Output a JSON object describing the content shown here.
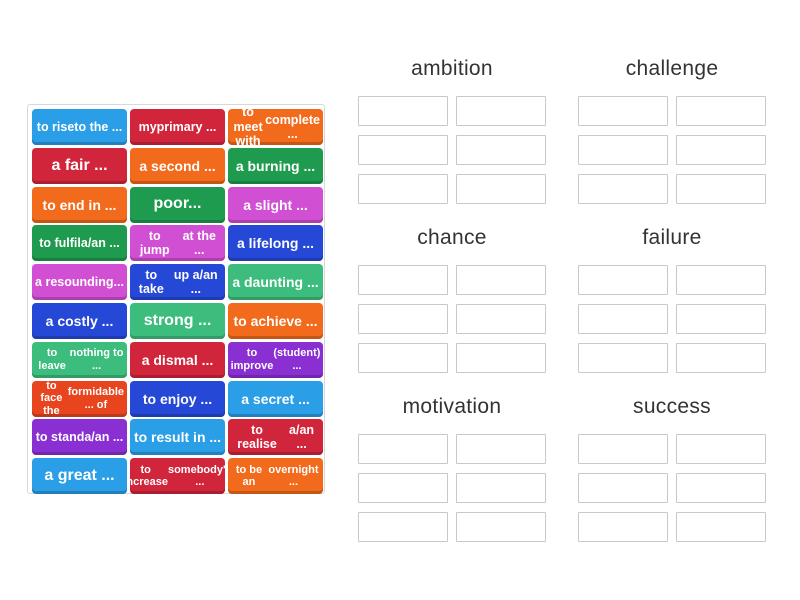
{
  "tiles": [
    {
      "text": "to rise\nto the ...",
      "color": "#2a9ee6"
    },
    {
      "text": "my\nprimary ...",
      "color": "#d1253c"
    },
    {
      "text": "to meet with\ncomplete ...",
      "color": "#f26a1b"
    },
    {
      "text": "a fair ...",
      "color": "#d1253c"
    },
    {
      "text": "a second ...",
      "color": "#f26a1b"
    },
    {
      "text": "a burning ...",
      "color": "#1e9b4e"
    },
    {
      "text": "to end in ...",
      "color": "#f26a1b"
    },
    {
      "text": "poor...",
      "color": "#1e9b4e"
    },
    {
      "text": "a slight ...",
      "color": "#d14fd3"
    },
    {
      "text": "to fulfil\na/an ...",
      "color": "#1e9b4e"
    },
    {
      "text": "to jump\nat the ...",
      "color": "#d14fd3"
    },
    {
      "text": "a lifelong ...",
      "color": "#2548d6"
    },
    {
      "text": "a resounding\n...",
      "color": "#d14fd3"
    },
    {
      "text": "to take\nup a/an ...",
      "color": "#2548d6"
    },
    {
      "text": "a daunting ...",
      "color": "#3dbd7d"
    },
    {
      "text": "a costly ...",
      "color": "#2548d6"
    },
    {
      "text": "strong ...",
      "color": "#3dbd7d"
    },
    {
      "text": "to achieve ...",
      "color": "#f26a1b"
    },
    {
      "text": "to leave\nnothing to ...",
      "color": "#3dbd7d"
    },
    {
      "text": "a dismal ...",
      "color": "#d1253c"
    },
    {
      "text": "to improve\n(student) ...",
      "color": "#8a2fd2"
    },
    {
      "text": "to face the\nformidable ... of",
      "color": "#e8451f"
    },
    {
      "text": "to enjoy ...",
      "color": "#2548d6"
    },
    {
      "text": "a secret ...",
      "color": "#2a9ee6"
    },
    {
      "text": "to stand\na/an ...",
      "color": "#8a2fd2"
    },
    {
      "text": "to result in ...",
      "color": "#2a9ee6"
    },
    {
      "text": "to realise\na/an ...",
      "color": "#d1253c"
    },
    {
      "text": "a great ...",
      "color": "#2a9ee6"
    },
    {
      "text": "to increase\nsomebody's ...",
      "color": "#d1253c"
    },
    {
      "text": "to be an\novernight ...",
      "color": "#f26a1b"
    }
  ],
  "categories": [
    {
      "title": "ambition"
    },
    {
      "title": "challenge"
    },
    {
      "title": "chance"
    },
    {
      "title": "failure"
    },
    {
      "title": "motivation"
    },
    {
      "title": "success"
    }
  ],
  "slots_per_category": 6
}
